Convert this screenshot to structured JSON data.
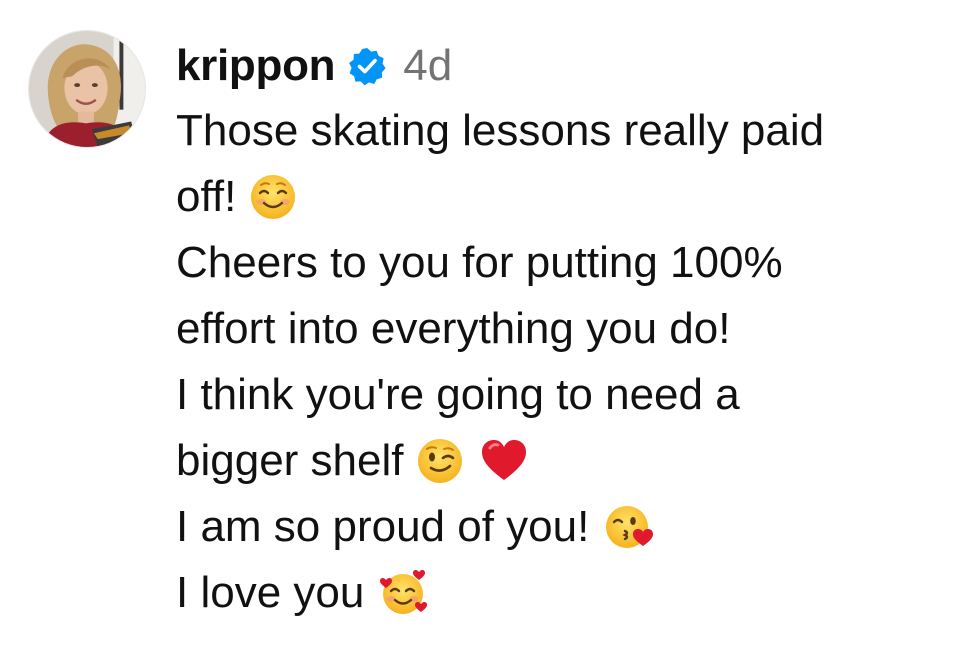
{
  "comment": {
    "username": "krippon",
    "timestamp": "4d",
    "lines": [
      "Those skating lessons really paid",
      "off!",
      "Cheers to you for putting 100%",
      "effort into everything you do!",
      "I think you're going to need a",
      "bigger shelf",
      "I am so proud of you!",
      "I love you"
    ],
    "icons": {
      "verified": "verified-badge-icon",
      "line2_emoji": "smiling-face-emoji",
      "line6_emoji_1": "winking-face-emoji",
      "line6_emoji_2": "red-heart-emoji",
      "line7_emoji": "face-blowing-kiss-emoji",
      "line8_emoji": "smiling-face-with-hearts-emoji"
    },
    "colors": {
      "verified_blue": "#0095f6",
      "timestamp_gray": "#737373",
      "text": "#111111",
      "heart_red": "#e0192d"
    }
  }
}
